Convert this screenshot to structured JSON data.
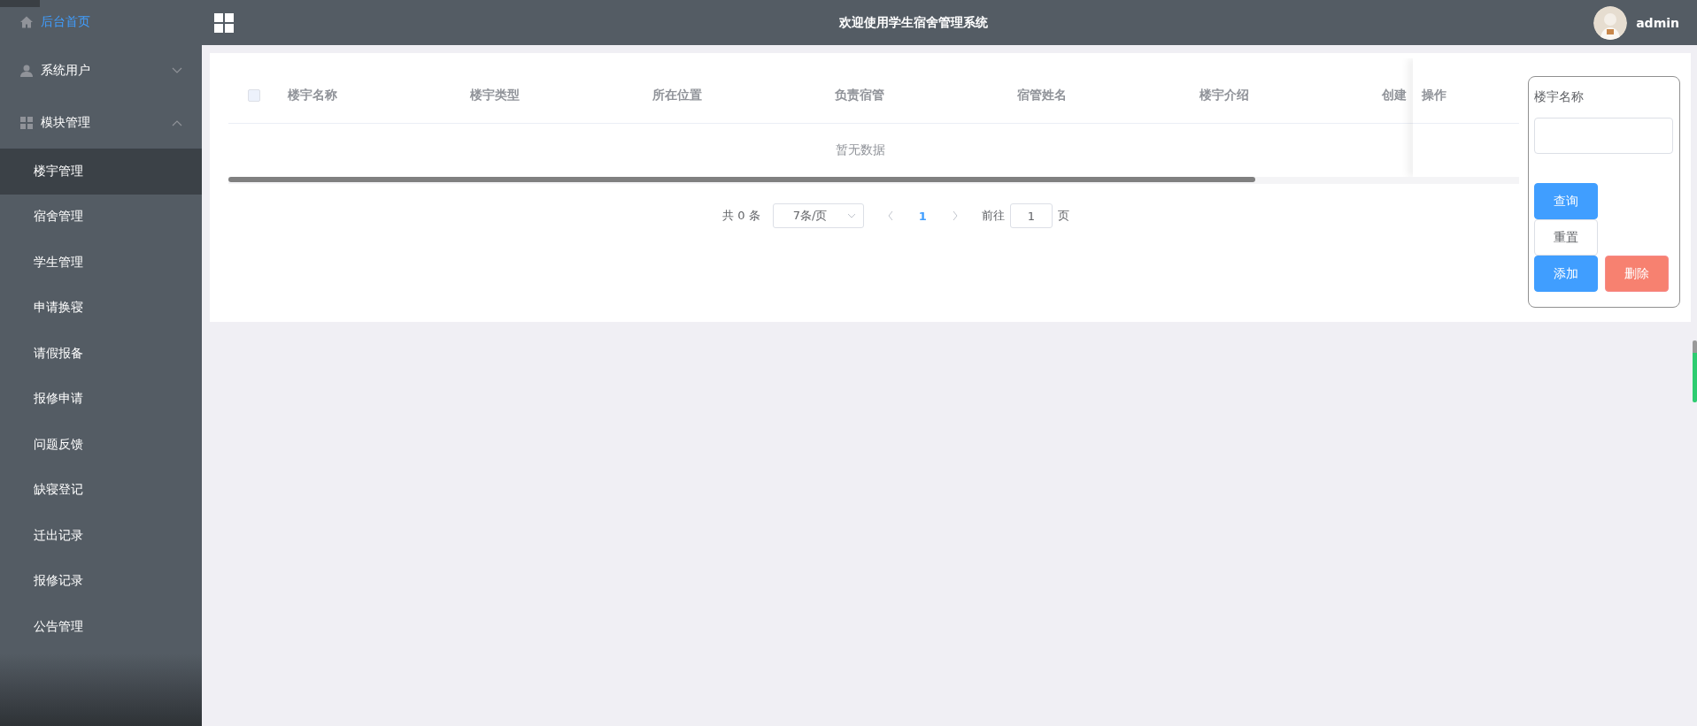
{
  "sidebar": {
    "items": [
      {
        "kind": "home",
        "label": "后台首页",
        "selected": true
      },
      {
        "kind": "user",
        "label": "系统用户",
        "selected": false,
        "expanded": false
      },
      {
        "kind": "grid",
        "label": "模块管理",
        "selected": false,
        "expanded": true,
        "children": [
          {
            "label": "楼宇管理",
            "selected": true
          },
          {
            "label": "宿舍管理",
            "selected": false
          },
          {
            "label": "学生管理",
            "selected": false
          },
          {
            "label": "申请换寝",
            "selected": false
          },
          {
            "label": "请假报备",
            "selected": false
          },
          {
            "label": "报修申请",
            "selected": false
          },
          {
            "label": "问题反馈",
            "selected": false
          },
          {
            "label": "缺寝登记",
            "selected": false
          },
          {
            "label": "迁出记录",
            "selected": false
          },
          {
            "label": "报修记录",
            "selected": false
          },
          {
            "label": "公告管理",
            "selected": false
          }
        ]
      }
    ]
  },
  "header": {
    "title": "欢迎使用学生宿舍管理系统",
    "user": "admin"
  },
  "table": {
    "select_all": {
      "checked": false
    },
    "columns": [
      "楼宇名称",
      "楼宇类型",
      "所在位置",
      "负责宿管",
      "宿管姓名",
      "楼宇介绍",
      "创建"
    ],
    "fixed_column": "操作",
    "empty_text": "暂无数据"
  },
  "pagination": {
    "total": "共 0 条",
    "page_size": "7条/页",
    "pages": [
      {
        "label": "1",
        "selected": true
      }
    ],
    "goto_label": "前往",
    "goto_value": "1",
    "goto_suffix": "页"
  },
  "search_panel": {
    "label": "楼宇名称",
    "buttons": [
      {
        "kind": "primary",
        "label": "查询"
      },
      {
        "kind": "plain",
        "label": "重置"
      },
      {
        "kind": "primary",
        "label": "添加"
      },
      {
        "kind": "danger",
        "label": "删除"
      }
    ]
  }
}
